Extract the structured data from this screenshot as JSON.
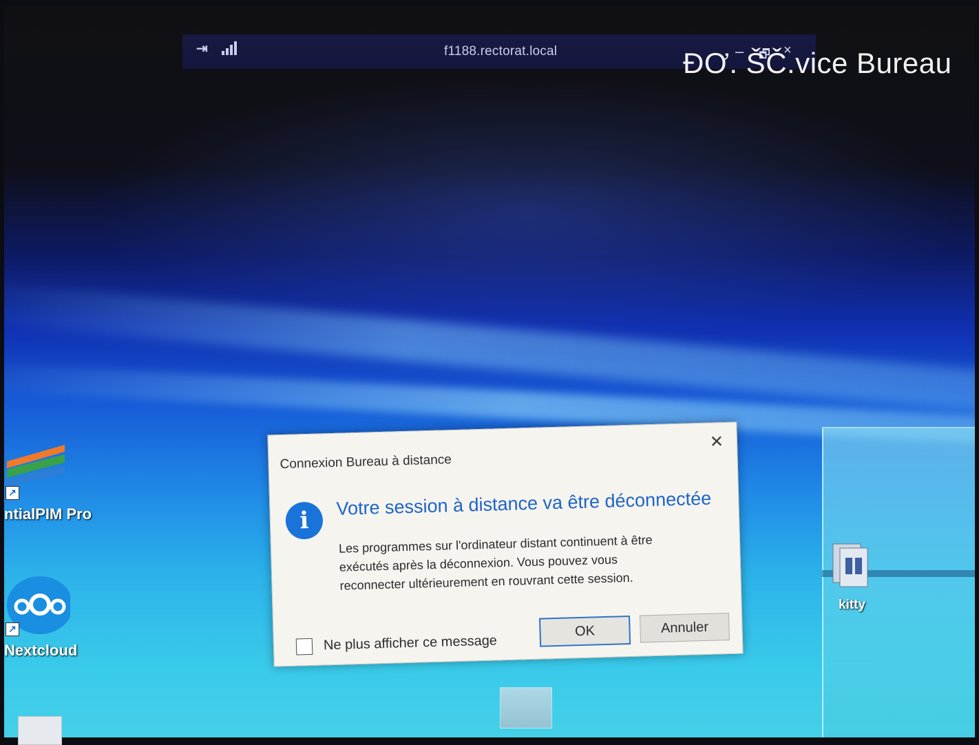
{
  "remote_bar": {
    "host": "f1188.rectorat.local",
    "pin_icon": "pin-icon",
    "signal_icon": "signal-bars-icon",
    "minimize_label": "–",
    "restore_label": "🗗",
    "close_label": "×"
  },
  "background_title": "ĐƠ. ŠČ.vice Bureau",
  "desktop_icons": [
    {
      "label": "ntialPIM Pro",
      "icon": "essentialpim-icon"
    },
    {
      "label": "Nextcloud",
      "icon": "nextcloud-icon"
    },
    {
      "label": "kitty",
      "icon": "kitty-icon"
    }
  ],
  "dialog": {
    "title": "Connexion Bureau à distance",
    "close_label": "✕",
    "icon": "info-icon",
    "icon_glyph": "i",
    "heading": "Votre session à distance va être déconnectée",
    "body_lines": [
      "Les programmes sur l'ordinateur distant continuent à être",
      "exécutés après la déconnexion. Vous pouvez vous",
      "reconnecter ultérieurement en rouvrant cette session."
    ],
    "checkbox_label": "Ne plus afficher ce message",
    "checkbox_checked": false,
    "ok_label": "OK",
    "cancel_label": "Annuler",
    "heading_color": "#1d64c8",
    "accent_color": "#1a73d8"
  }
}
